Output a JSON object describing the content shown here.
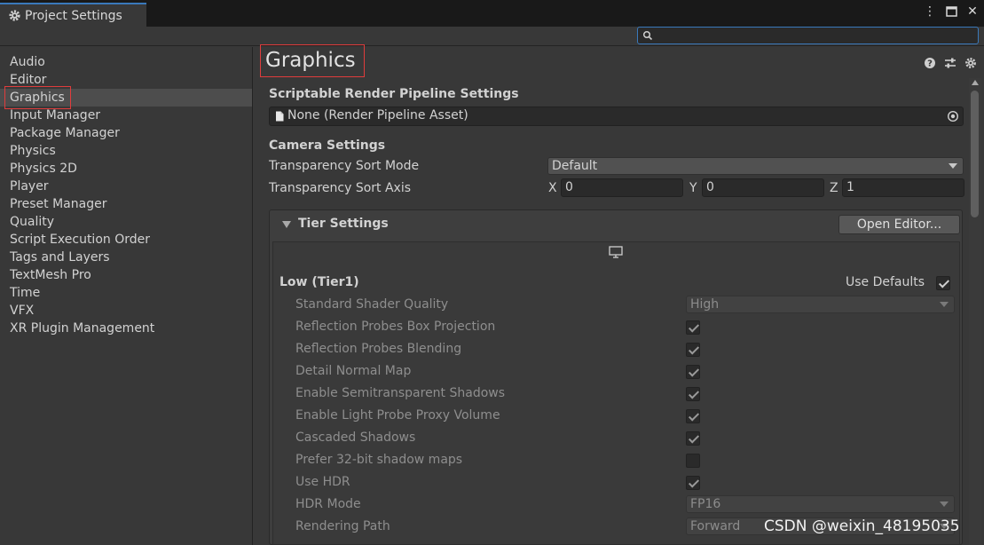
{
  "window": {
    "tab_title": "Project Settings"
  },
  "search": {
    "placeholder": "",
    "value": ""
  },
  "sidebar": {
    "items": [
      {
        "label": "Audio"
      },
      {
        "label": "Editor"
      },
      {
        "label": "Graphics",
        "selected": true
      },
      {
        "label": "Input Manager"
      },
      {
        "label": "Package Manager"
      },
      {
        "label": "Physics"
      },
      {
        "label": "Physics 2D"
      },
      {
        "label": "Player"
      },
      {
        "label": "Preset Manager"
      },
      {
        "label": "Quality"
      },
      {
        "label": "Script Execution Order"
      },
      {
        "label": "Tags and Layers"
      },
      {
        "label": "TextMesh Pro"
      },
      {
        "label": "Time"
      },
      {
        "label": "VFX"
      },
      {
        "label": "XR Plugin Management"
      }
    ]
  },
  "main": {
    "title": "Graphics",
    "srp": {
      "heading": "Scriptable Render Pipeline Settings",
      "value": "None (Render Pipeline Asset)"
    },
    "camera": {
      "heading": "Camera Settings",
      "sort_mode_label": "Transparency Sort Mode",
      "sort_mode_value": "Default",
      "sort_axis_label": "Transparency Sort Axis",
      "x_label": "X",
      "x_value": "0",
      "y_label": "Y",
      "y_value": "0",
      "z_label": "Z",
      "z_value": "1"
    },
    "tier": {
      "heading": "Tier Settings",
      "open_editor": "Open Editor...",
      "tier_name": "Low (Tier1)",
      "use_defaults_label": "Use Defaults",
      "use_defaults": true,
      "rows": [
        {
          "label": "Standard Shader Quality",
          "type": "dropdown",
          "value": "High"
        },
        {
          "label": "Reflection Probes Box Projection",
          "type": "check",
          "value": true
        },
        {
          "label": "Reflection Probes Blending",
          "type": "check",
          "value": true
        },
        {
          "label": "Detail Normal Map",
          "type": "check",
          "value": true
        },
        {
          "label": "Enable Semitransparent Shadows",
          "type": "check",
          "value": true
        },
        {
          "label": "Enable Light Probe Proxy Volume",
          "type": "check",
          "value": true
        },
        {
          "label": "Cascaded Shadows",
          "type": "check",
          "value": true
        },
        {
          "label": "Prefer 32-bit shadow maps",
          "type": "check",
          "value": false
        },
        {
          "label": "Use HDR",
          "type": "check",
          "value": true
        },
        {
          "label": "HDR Mode",
          "type": "dropdown",
          "value": "FP16"
        },
        {
          "label": "Rendering Path",
          "type": "dropdown",
          "value": "Forward"
        }
      ]
    }
  },
  "watermark": "CSDN @weixin_48195035",
  "colors": {
    "accent": "#3a79bb",
    "highlight_box": "#e03c3c",
    "panel_bg": "#383838"
  }
}
